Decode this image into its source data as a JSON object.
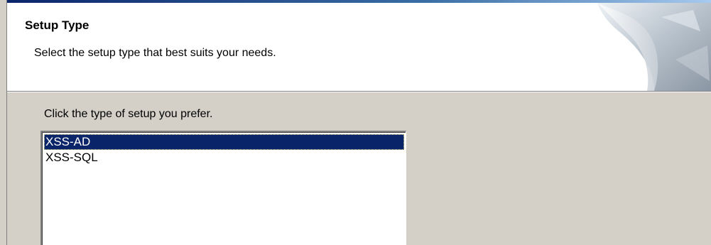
{
  "header": {
    "title": "Setup Type",
    "subtitle": "Select the setup type that best suits your needs."
  },
  "main": {
    "prompt": "Click the type of setup you prefer.",
    "setup_types": [
      {
        "label": "XSS-AD",
        "selected": true
      },
      {
        "label": "XSS-SQL",
        "selected": false
      }
    ]
  },
  "colors": {
    "selection": "#0a246a",
    "dialog_bg": "#d4d0c8"
  }
}
